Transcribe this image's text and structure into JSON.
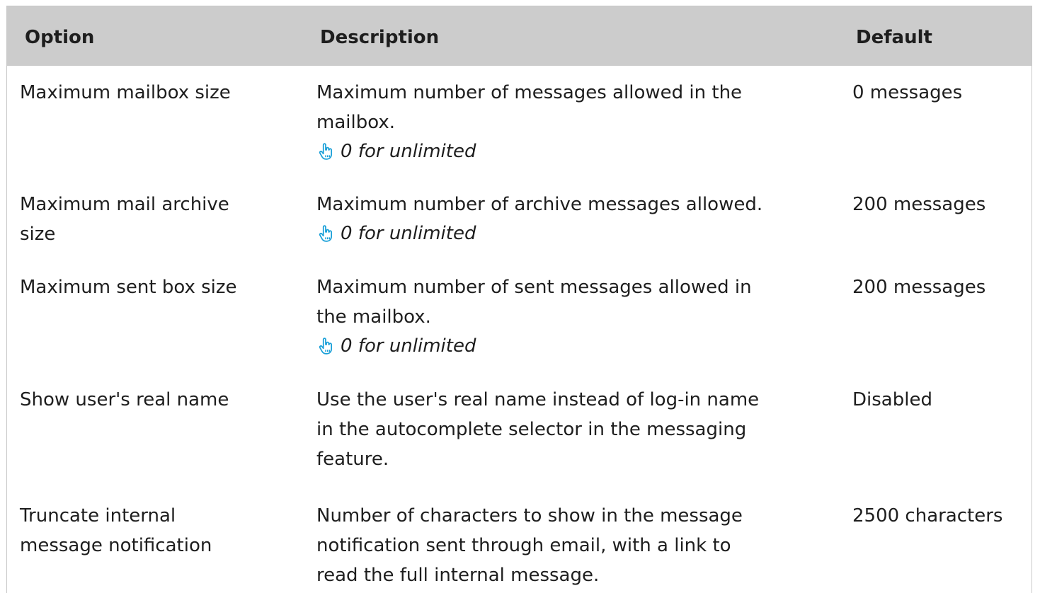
{
  "table": {
    "headers": {
      "option": "Option",
      "description": "Description",
      "default": "Default"
    },
    "rows": [
      {
        "option": [
          "Maximum mailbox size"
        ],
        "description": [
          "Maximum number of messages allowed in the",
          "mailbox."
        ],
        "note": "0 for unlimited",
        "default": "0 messages"
      },
      {
        "option": [
          "Maximum mail archive",
          "size"
        ],
        "description": [
          "Maximum number of archive messages allowed."
        ],
        "note": "0 for unlimited",
        "default": "200 messages"
      },
      {
        "option": [
          "Maximum sent box size"
        ],
        "description": [
          "Maximum number of sent messages allowed in",
          "the mailbox."
        ],
        "note": "0 for unlimited",
        "default": "200 messages"
      },
      {
        "option": [
          "Show user's real name"
        ],
        "description": [
          "Use the user's real name instead of log-in name",
          "in the autocomplete selector in the messaging",
          "feature."
        ],
        "default": "Disabled"
      },
      {
        "option": [
          "Truncate internal",
          "message notification"
        ],
        "description": [
          "Number of characters to show in the message",
          "notification sent through email, with a link to",
          "read the full internal message."
        ],
        "default": "2500 characters"
      }
    ],
    "note_icon": "pointing-hand-icon",
    "note_icon_color": "#1aa0d8"
  }
}
